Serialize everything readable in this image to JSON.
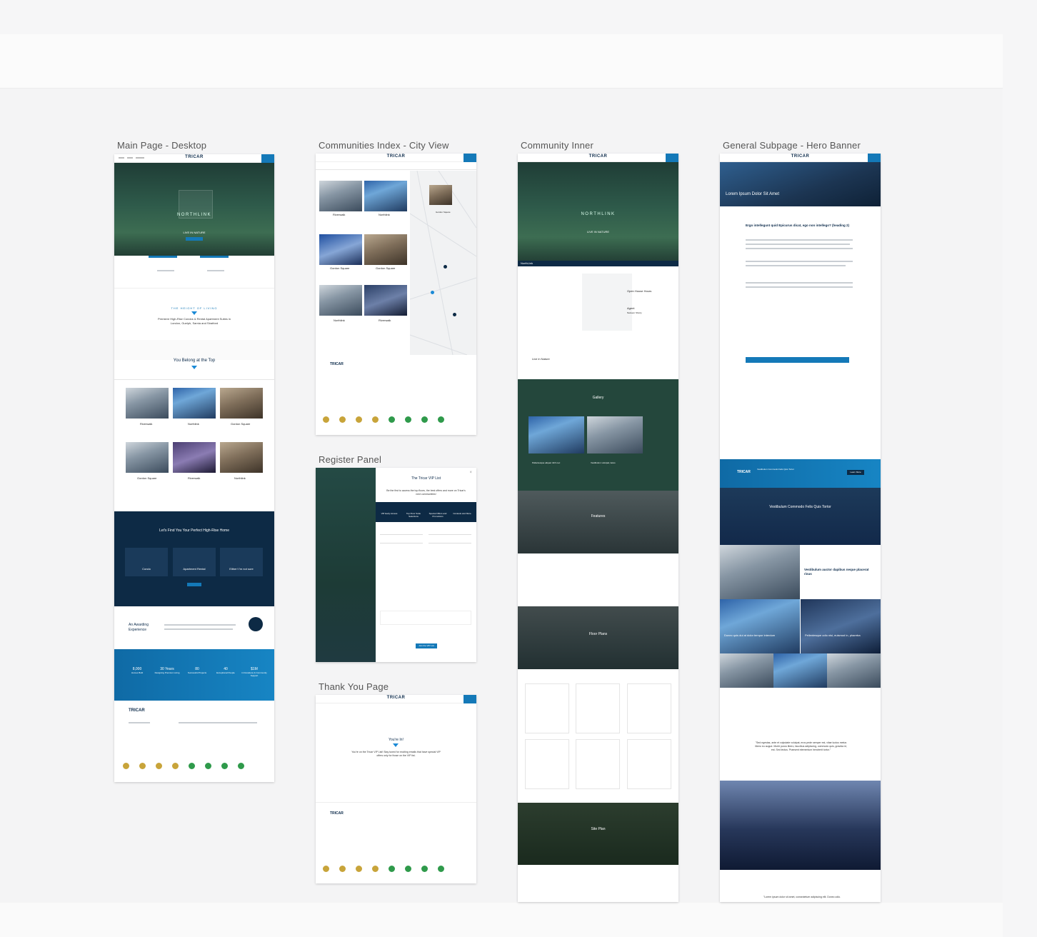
{
  "boards": [
    {
      "title": "Main Page - Desktop"
    },
    {
      "title": "Communities Index - City View"
    },
    {
      "title": "Community Inner"
    },
    {
      "title": "General Subpage - Hero Banner"
    },
    {
      "title": "Register Panel"
    },
    {
      "title": "Thank You Page"
    }
  ],
  "brand": {
    "logo": "TRICAR",
    "accent": "#1479b8",
    "navy": "#0d2a45"
  },
  "main": {
    "hero_word": "NORTHLINK",
    "hero_tag": "LIVE IN NATURE",
    "height_title": "THE HEIGHT OF LIVING",
    "height_sub": "Premiere High-Rise Condos & Rental Apartment Suites in London, Guelph, Sarnia and Stratford",
    "belong": "You Belong at the Top",
    "cards": [
      "Riverwalk",
      "Northlink",
      "Gordon Square",
      "Gordon Square",
      "Riverwalk",
      "Northlink"
    ],
    "find_title": "Let's Find You Your Perfect High-Rise Home",
    "find_options": [
      "Condo",
      "Apartment Rental",
      "Either! I'm not sure"
    ],
    "award": "An Awarding Experience",
    "stats": [
      {
        "value": "8,000",
        "label": "Homes Built"
      },
      {
        "value": "30 Years",
        "label": "Designing Premium Living"
      },
      {
        "value": "80",
        "label": "Successful Projects"
      },
      {
        "value": "40",
        "label": "Exceptional People"
      },
      {
        "value": "$1M",
        "label": "in Donations & Community Support"
      }
    ]
  },
  "index": {
    "cards": [
      "Riverwalk",
      "Northlink",
      "Gordon Square",
      "Gordon Square",
      "Northlink",
      "Riverwalk"
    ],
    "map_card": "Gordon Square"
  },
  "inner": {
    "hero_word": "NORTHLINK",
    "hero_tag": "LIVE IN NATURE",
    "bar_label": "NorthLink",
    "open_house": "Open House Hours",
    "agent": "Agent",
    "agent_name": "Nazeem Shorty",
    "live": "Live in Nature",
    "gallery": "Gallery",
    "gallery_items": [
      "Pellentesque aliquet nibh nec",
      "Vestibulum volutpat, lacus"
    ],
    "features": "Features",
    "floor_plans": "Floor Plans",
    "site_plan": "Site Plan"
  },
  "sub": {
    "hero": "Lorem Ipsum Dolor Sit Amet",
    "h2": "Ergo intellegunt quid Epicurus dicat, ego non intellego? (heading 2)",
    "cta": "Vestibulum Commodo Felis Quis Tortor",
    "cta_btn": "Learn More",
    "banner": "Vestibulum Commodo Felis Quis Tortor",
    "feature": "Vestibulum auctor dapibus neque placerat risus",
    "tile1": "Donec quis dui at dolor tempor interdum",
    "tile2": "Pellentesque odio nisi, euismod in, pharetra",
    "quote": "\"Sed egestas, ante et vulputate volutpat, eros pede semper est, vitae luctus metus libero eu augue. Morbi purus libero, faucibus adipiscing, commodo quis, gravida id, est. Sed lectus. Praesent elementum hendrerit tortor.\"",
    "quote2": "\"Lorem ipsum dolor sit amet, consectetuer adipiscing elit. Donec odio."
  },
  "register": {
    "title": "The Tricar VIP List",
    "sub": "Be the first to access the top floors, the best offers and more on Tricar's next communities!",
    "perks": [
      "VIP Early Access",
      "Top Floor Suite Selections",
      "Special Offers and Promotions",
      "Contests and More"
    ],
    "submit": "Join the VIP List"
  },
  "thanks": {
    "title": "You're In!",
    "body": "You're on the Tricar VIP List! Stay tuned for exciting emails that have special VIP offers only for those on the VIP list."
  }
}
